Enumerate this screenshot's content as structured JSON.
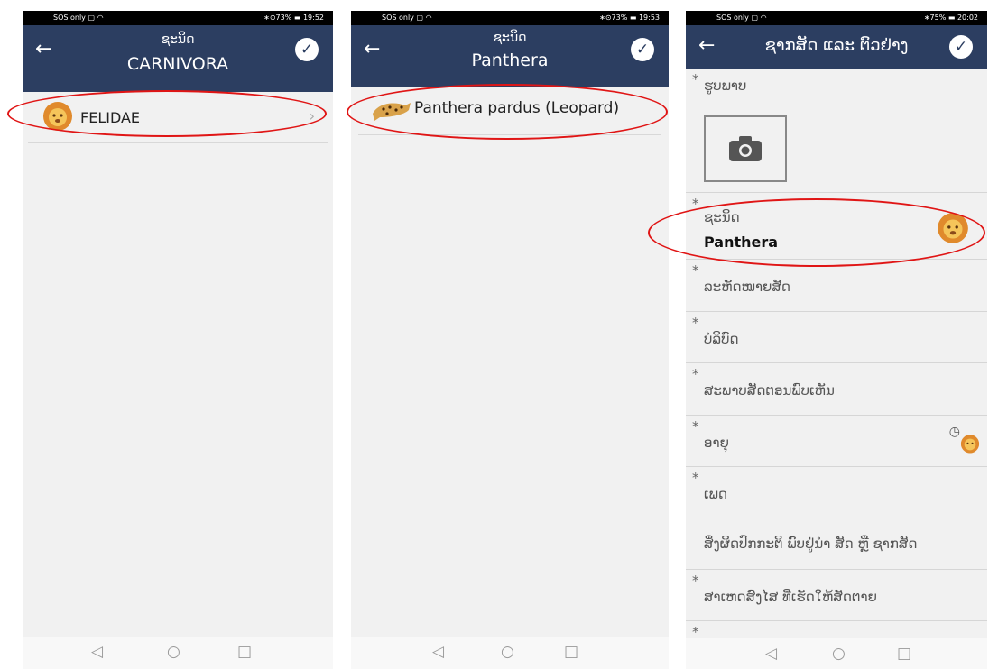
{
  "screens": [
    {
      "status": {
        "left": "SOS only ▢ ◠",
        "right": "∗⊙73% ▬ 19:52"
      },
      "header": {
        "line1": "ຊະນິດ",
        "line2": "CARNIVORA"
      },
      "items": [
        {
          "label": "FELIDAE",
          "icon": "lion-icon"
        }
      ]
    },
    {
      "status": {
        "left": "SOS only ▢ ◠",
        "right": "∗⊙73% ▬ 19:53"
      },
      "header": {
        "line1": "ຊະນິດ",
        "line2": "Panthera"
      },
      "items": [
        {
          "label": "Panthera pardus (Leopard)",
          "icon": "leopard-icon"
        }
      ]
    },
    {
      "status": {
        "left": "SOS only ▢ ◠",
        "right": "∗75% ▬ 20:02"
      },
      "header": {
        "title": "ຊາກສັດ ແລະ ຕົວຢ່າງ"
      },
      "fields": {
        "photo": "ຮູບພາບ",
        "species": "ຊະນິດ",
        "species_value": "Panthera",
        "f1": "ລະຫັດໝາຍສັດ",
        "f2": "ບໍລິບົດ",
        "f3": "ສະພາບສັດຕອນພົບເຫັນ",
        "f4": "ອາຍຸ",
        "f5": "ເພດ",
        "f6": "ສິ່ງຜິດປົກກະຕິ ພົບຢູ່ນຳ ສັດ ຫຼື ຊາກສັດ",
        "f7": "ສາເຫດສົງໄສ ທີ່ເຮັດໃຫ້ສັດຕາຍ"
      }
    }
  ],
  "icons": {
    "back": "back-arrow-icon",
    "confirm": "check-circle-icon",
    "camera": "camera-icon",
    "history": "clock-icon"
  },
  "colors": {
    "appbar": "#2c3e61",
    "highlight": "#e01515"
  }
}
